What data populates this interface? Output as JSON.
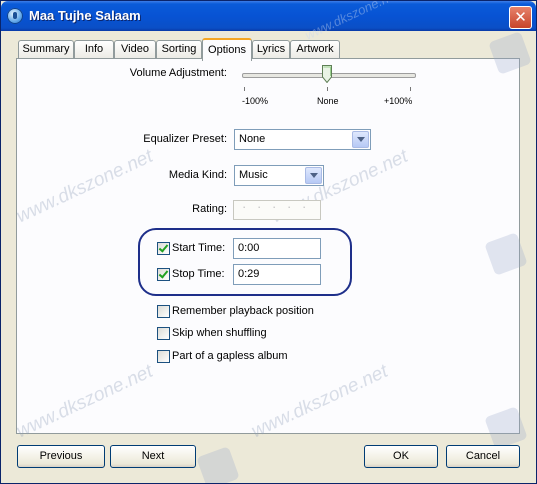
{
  "window": {
    "title": "Maa Tujhe Salaam",
    "close_glyph": "✕"
  },
  "tabs": [
    {
      "label": "Summary"
    },
    {
      "label": "Info"
    },
    {
      "label": "Video"
    },
    {
      "label": "Sorting"
    },
    {
      "label": "Options",
      "active": true
    },
    {
      "label": "Lyrics"
    },
    {
      "label": "Artwork"
    }
  ],
  "options": {
    "volume": {
      "label": "Volume Adjustment:",
      "min_label": "-100%",
      "mid_label": "None",
      "max_label": "+100%",
      "value_percent": 0
    },
    "equalizer": {
      "label": "Equalizer Preset:",
      "value": "None"
    },
    "media_kind": {
      "label": "Media Kind:",
      "value": "Music"
    },
    "rating": {
      "label": "Rating:",
      "stars": 0,
      "max": 5,
      "dot": "·"
    },
    "start_time": {
      "label": "Start Time:",
      "checked": true,
      "value": "0:00"
    },
    "stop_time": {
      "label": "Stop Time:",
      "checked": true,
      "value": "0:29"
    },
    "remember_playback": {
      "label": "Remember playback position",
      "checked": false
    },
    "skip_shuffling": {
      "label": "Skip when shuffling",
      "checked": false
    },
    "gapless": {
      "label": "Part of a gapless album",
      "checked": false
    }
  },
  "buttons": {
    "previous": "Previous",
    "next": "Next",
    "ok": "OK",
    "cancel": "Cancel"
  },
  "watermark": {
    "text": "www.dkszone.net"
  },
  "colors": {
    "title_bar": "#0753d4",
    "active_tab_accent": "#f5a623",
    "highlight_ring": "#1e2f8a",
    "check": "#21a121"
  }
}
